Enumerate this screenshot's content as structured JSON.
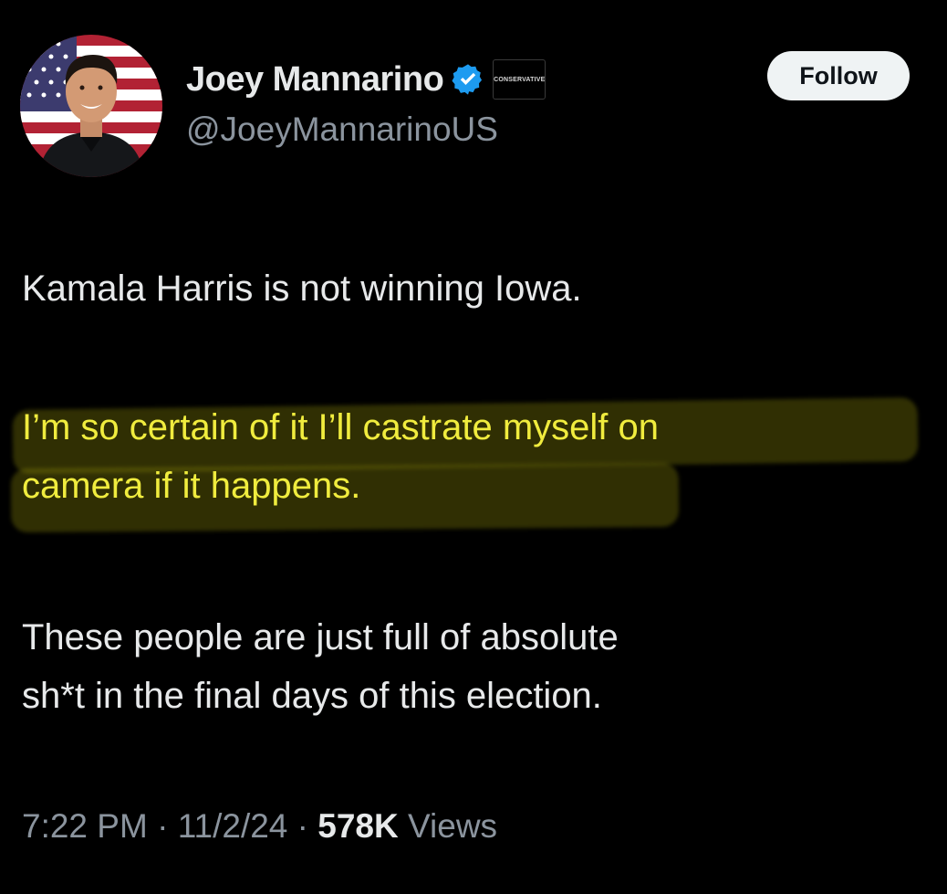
{
  "tweet": {
    "author": {
      "display_name": "Joey Mannarino",
      "handle": "@JoeyMannarinoUS",
      "verified_icon": "verified-badge-icon",
      "affiliate_badge": "CONSERVATIVE",
      "avatar_icon": "profile-photo"
    },
    "follow_label": "Follow",
    "body": {
      "paragraph_1": "Kamala Harris is not winning Iowa.",
      "paragraph_2_line_1": "I’m so certain of it I’ll castrate myself on",
      "paragraph_2_line_2": "camera if it happens.",
      "paragraph_3_line_1": "These people are just full of absolute",
      "paragraph_3_line_2": "sh*t in the final days of this election."
    },
    "meta": {
      "time": "7:22 PM",
      "separator": "·",
      "date": "11/2/24",
      "views_count": "578K",
      "views_label": "Views"
    }
  },
  "colors": {
    "background": "#000000",
    "text": "#e7e9ea",
    "secondary_text": "#8b949e",
    "verified_blue": "#1d9bf0",
    "highlight_text": "#f0ec3e",
    "follow_bg": "#eff3f4"
  }
}
